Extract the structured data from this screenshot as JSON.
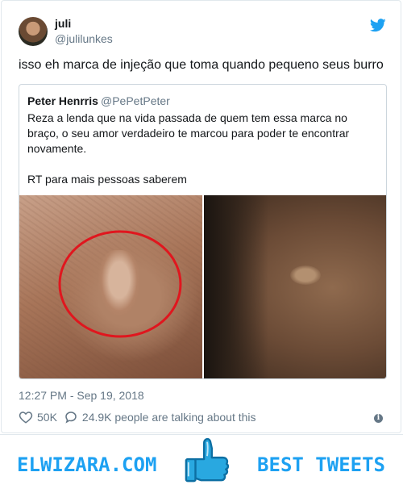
{
  "tweet": {
    "display_name": "juli",
    "handle": "@julilunkes",
    "text": "isso eh marca de injeção que toma quando pequeno seus burro",
    "timestamp": "12:27 PM - Sep 19, 2018",
    "likes": "50K",
    "talking": "24.9K people are talking about this"
  },
  "quote": {
    "display_name": "Peter Henrris",
    "handle": "@PePetPeter",
    "line1": "Reza a lenda que na vida passada de quem tem essa marca no",
    "line2": "braço, o seu amor verdadeiro te marcou para poder te encontrar",
    "line3": "novamente.",
    "line4": "RT para mais pessoas saberem"
  },
  "footer": {
    "left": "ELWIZARA.COM",
    "right": "BEST TWEETS"
  },
  "colors": {
    "twitter_blue": "#1da1f2",
    "muted_text": "#657786",
    "highlight_circle": "#e0161e"
  },
  "icons": {
    "brand": "twitter-bird-icon",
    "like": "heart-icon",
    "reply": "speech-bubble-icon",
    "info": "info-icon",
    "footer_logo": "thumbs-up-icon"
  }
}
